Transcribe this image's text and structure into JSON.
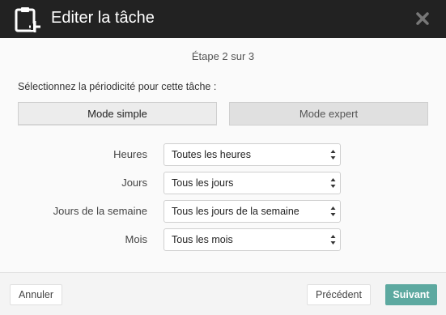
{
  "dialog": {
    "title": "Editer la tâche",
    "step_text": "Étape 2 sur 3",
    "prompt": "Sélectionnez la périodicité pour cette tâche :",
    "colors": {
      "header_bg": "#222222",
      "accent": "#5da9a0"
    }
  },
  "modes": {
    "simple_label": "Mode simple",
    "expert_label": "Mode expert",
    "active": "simple"
  },
  "fields": [
    {
      "label": "Heures",
      "value": "Toutes les heures"
    },
    {
      "label": "Jours",
      "value": "Tous les jours"
    },
    {
      "label": "Jours de la semaine",
      "value": "Tous les jours de la semaine"
    },
    {
      "label": "Mois",
      "value": "Tous les mois"
    }
  ],
  "footer": {
    "cancel_label": "Annuler",
    "previous_label": "Précédent",
    "next_label": "Suivant"
  },
  "icons": {
    "header": "clipboard-plus-icon",
    "close": "close-icon",
    "select_arrows": "updown-arrows-icon"
  }
}
